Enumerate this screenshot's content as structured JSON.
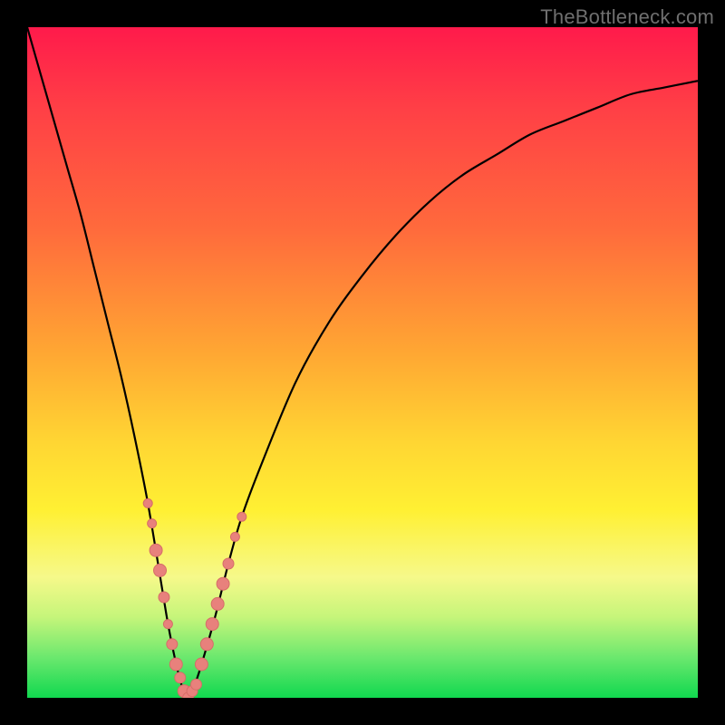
{
  "watermark": "TheBottleneck.com",
  "colors": {
    "frame": "#000000",
    "curve": "#000000",
    "marker_fill": "#e8817c",
    "marker_stroke": "#d66d68"
  },
  "chart_data": {
    "type": "line",
    "title": "",
    "xlabel": "",
    "ylabel": "",
    "xlim": [
      0,
      100
    ],
    "ylim": [
      0,
      100
    ],
    "grid": false,
    "legend": null,
    "series": [
      {
        "name": "bottleneck-curve",
        "x": [
          0,
          2,
          4,
          6,
          8,
          10,
          12,
          14,
          16,
          18,
          20,
          21,
          22,
          23,
          24,
          25,
          26,
          28,
          30,
          32,
          35,
          40,
          45,
          50,
          55,
          60,
          65,
          70,
          75,
          80,
          85,
          90,
          95,
          100
        ],
        "y": [
          100,
          93,
          86,
          79,
          72,
          64,
          56,
          48,
          39,
          29,
          17,
          11,
          6,
          2,
          0,
          2,
          5,
          12,
          20,
          27,
          35,
          47,
          56,
          63,
          69,
          74,
          78,
          81,
          84,
          86,
          88,
          90,
          91,
          92
        ]
      }
    ],
    "markers": [
      {
        "x": 18.0,
        "y": 29,
        "size": 5
      },
      {
        "x": 18.6,
        "y": 26,
        "size": 5
      },
      {
        "x": 19.2,
        "y": 22,
        "size": 7
      },
      {
        "x": 19.8,
        "y": 19,
        "size": 7
      },
      {
        "x": 20.4,
        "y": 15,
        "size": 6
      },
      {
        "x": 21.0,
        "y": 11,
        "size": 5
      },
      {
        "x": 21.6,
        "y": 8,
        "size": 6
      },
      {
        "x": 22.2,
        "y": 5,
        "size": 7
      },
      {
        "x": 22.8,
        "y": 3,
        "size": 6
      },
      {
        "x": 23.4,
        "y": 1,
        "size": 7
      },
      {
        "x": 24.0,
        "y": 0,
        "size": 6
      },
      {
        "x": 24.6,
        "y": 1,
        "size": 6
      },
      {
        "x": 25.2,
        "y": 2,
        "size": 6
      },
      {
        "x": 26.0,
        "y": 5,
        "size": 7
      },
      {
        "x": 26.8,
        "y": 8,
        "size": 7
      },
      {
        "x": 27.6,
        "y": 11,
        "size": 7
      },
      {
        "x": 28.4,
        "y": 14,
        "size": 7
      },
      {
        "x": 29.2,
        "y": 17,
        "size": 7
      },
      {
        "x": 30.0,
        "y": 20,
        "size": 6
      },
      {
        "x": 31.0,
        "y": 24,
        "size": 5
      },
      {
        "x": 32.0,
        "y": 27,
        "size": 5
      }
    ]
  }
}
